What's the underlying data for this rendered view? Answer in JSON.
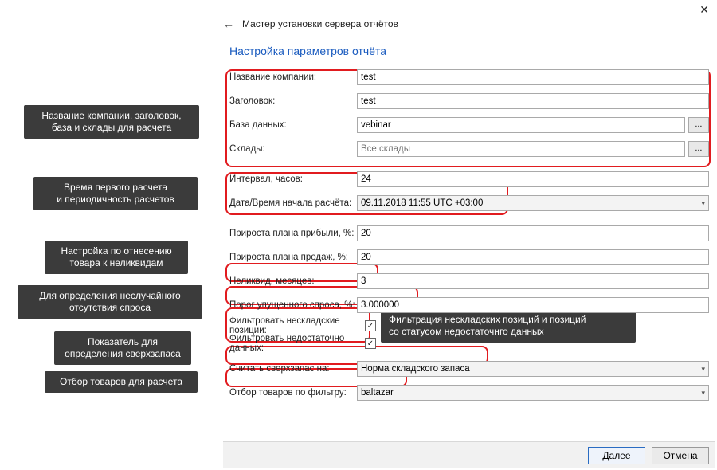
{
  "window": {
    "close": "✕"
  },
  "wizard": {
    "back_glyph": "←",
    "title": "Мастер установки сервера отчётов",
    "section": "Настройка параметров отчёта"
  },
  "fields": {
    "company_label": "Название компании:",
    "company_value": "test",
    "header_label": "Заголовок:",
    "header_value": "test",
    "db_label": "База данных:",
    "db_value": "vebinar",
    "db_button": "...",
    "wh_label": "Склады:",
    "wh_placeholder": "Все склады",
    "wh_button": "...",
    "interval_label": "Интервал, часов:",
    "interval_value": "24",
    "start_label": "Дата/Время начала расчёта:",
    "start_value": "09.11.2018 11:55 UTC +03:00",
    "profit_label": "Прироста плана прибыли, %:",
    "profit_value": "20",
    "sales_label": "Прироста плана продаж, %:",
    "sales_value": "20",
    "illiquid_label": "Неликвид, месяцев:",
    "illiquid_value": "3",
    "missed_label": "Порог упущенного спроса, %:",
    "missed_value": "3.000000",
    "filter_nonstock_label": "Фильтровать нескладские позиции:",
    "filter_lowdata_label": "Фильтровать недостаточно данных:",
    "overstock_label": "Считать сверхзапас на:",
    "overstock_value": "Норма складского запаса",
    "select_label": "Отбор товаров по фильтру:",
    "select_value": "baltazar"
  },
  "checks": {
    "mark": "✓"
  },
  "footer": {
    "next": "Далее",
    "cancel": "Отмена"
  },
  "annot": {
    "a1": "Название компании, заголовок,\nбаза и склады для расчета",
    "a2": "Время первого расчета\nи периодичность расчетов",
    "a3": "Настройка по отнесению\nтовара к неликвидам",
    "a4": "Для определения неслучайного\nотсутствия спроса",
    "a5": "Показатель для\nопределения сверхзапаса",
    "a6": "Отбор товаров для расчета",
    "a7": "Фильтрация нескладских позиций и позиций\nсо статусом недостаточнго данных"
  }
}
